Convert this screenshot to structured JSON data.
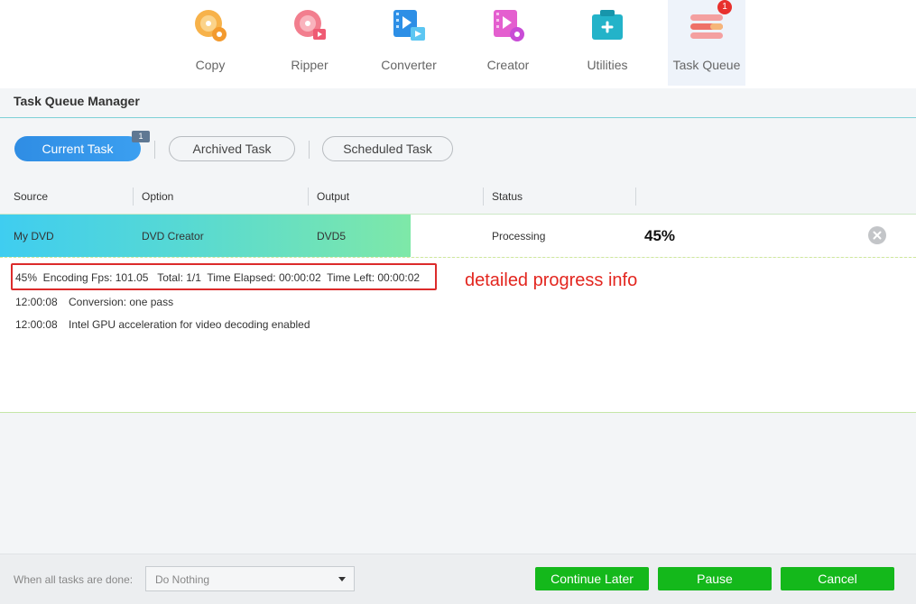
{
  "nav": {
    "items": [
      {
        "label": "Copy",
        "icon": "copy-disc-icon"
      },
      {
        "label": "Ripper",
        "icon": "ripper-disc-icon"
      },
      {
        "label": "Converter",
        "icon": "converter-film-icon"
      },
      {
        "label": "Creator",
        "icon": "creator-film-disc-icon"
      },
      {
        "label": "Utilities",
        "icon": "utilities-toolbox-icon"
      },
      {
        "label": "Task Queue",
        "icon": "task-queue-icon",
        "badge": "1",
        "active": true
      }
    ]
  },
  "page": {
    "title": "Task Queue Manager"
  },
  "tabs": {
    "current": {
      "label": "Current Task",
      "count": "1"
    },
    "archived": {
      "label": "Archived Task"
    },
    "scheduled": {
      "label": "Scheduled Task"
    }
  },
  "table": {
    "columns": [
      "Source",
      "Option",
      "Output",
      "Status"
    ],
    "row": {
      "source": "My DVD",
      "option": "DVD Creator",
      "output": "DVD5",
      "status": "Processing",
      "progress_label": "45%",
      "progress": 0.45
    }
  },
  "log": {
    "lines": [
      {
        "time": "",
        "text": "45%  Encoding Fps: 101.05   Total: 1/1  Time Elapsed: 00:00:02  Time Left: 00:00:02"
      },
      {
        "time": "12:00:08",
        "text": "Conversion: one pass"
      },
      {
        "time": "12:00:08",
        "text": "Intel GPU acceleration for video decoding enabled"
      }
    ]
  },
  "annotation": {
    "text": "detailed progress info"
  },
  "footer": {
    "when_label": "When all tasks are done:",
    "when_value": "Do Nothing",
    "continue_later": "Continue Later",
    "pause": "Pause",
    "cancel": "Cancel"
  },
  "colors": {
    "accent_blue": "#2f8de4",
    "action_green": "#14b81b",
    "badge_red": "#e8302d",
    "annotation_red": "#e3261f"
  }
}
